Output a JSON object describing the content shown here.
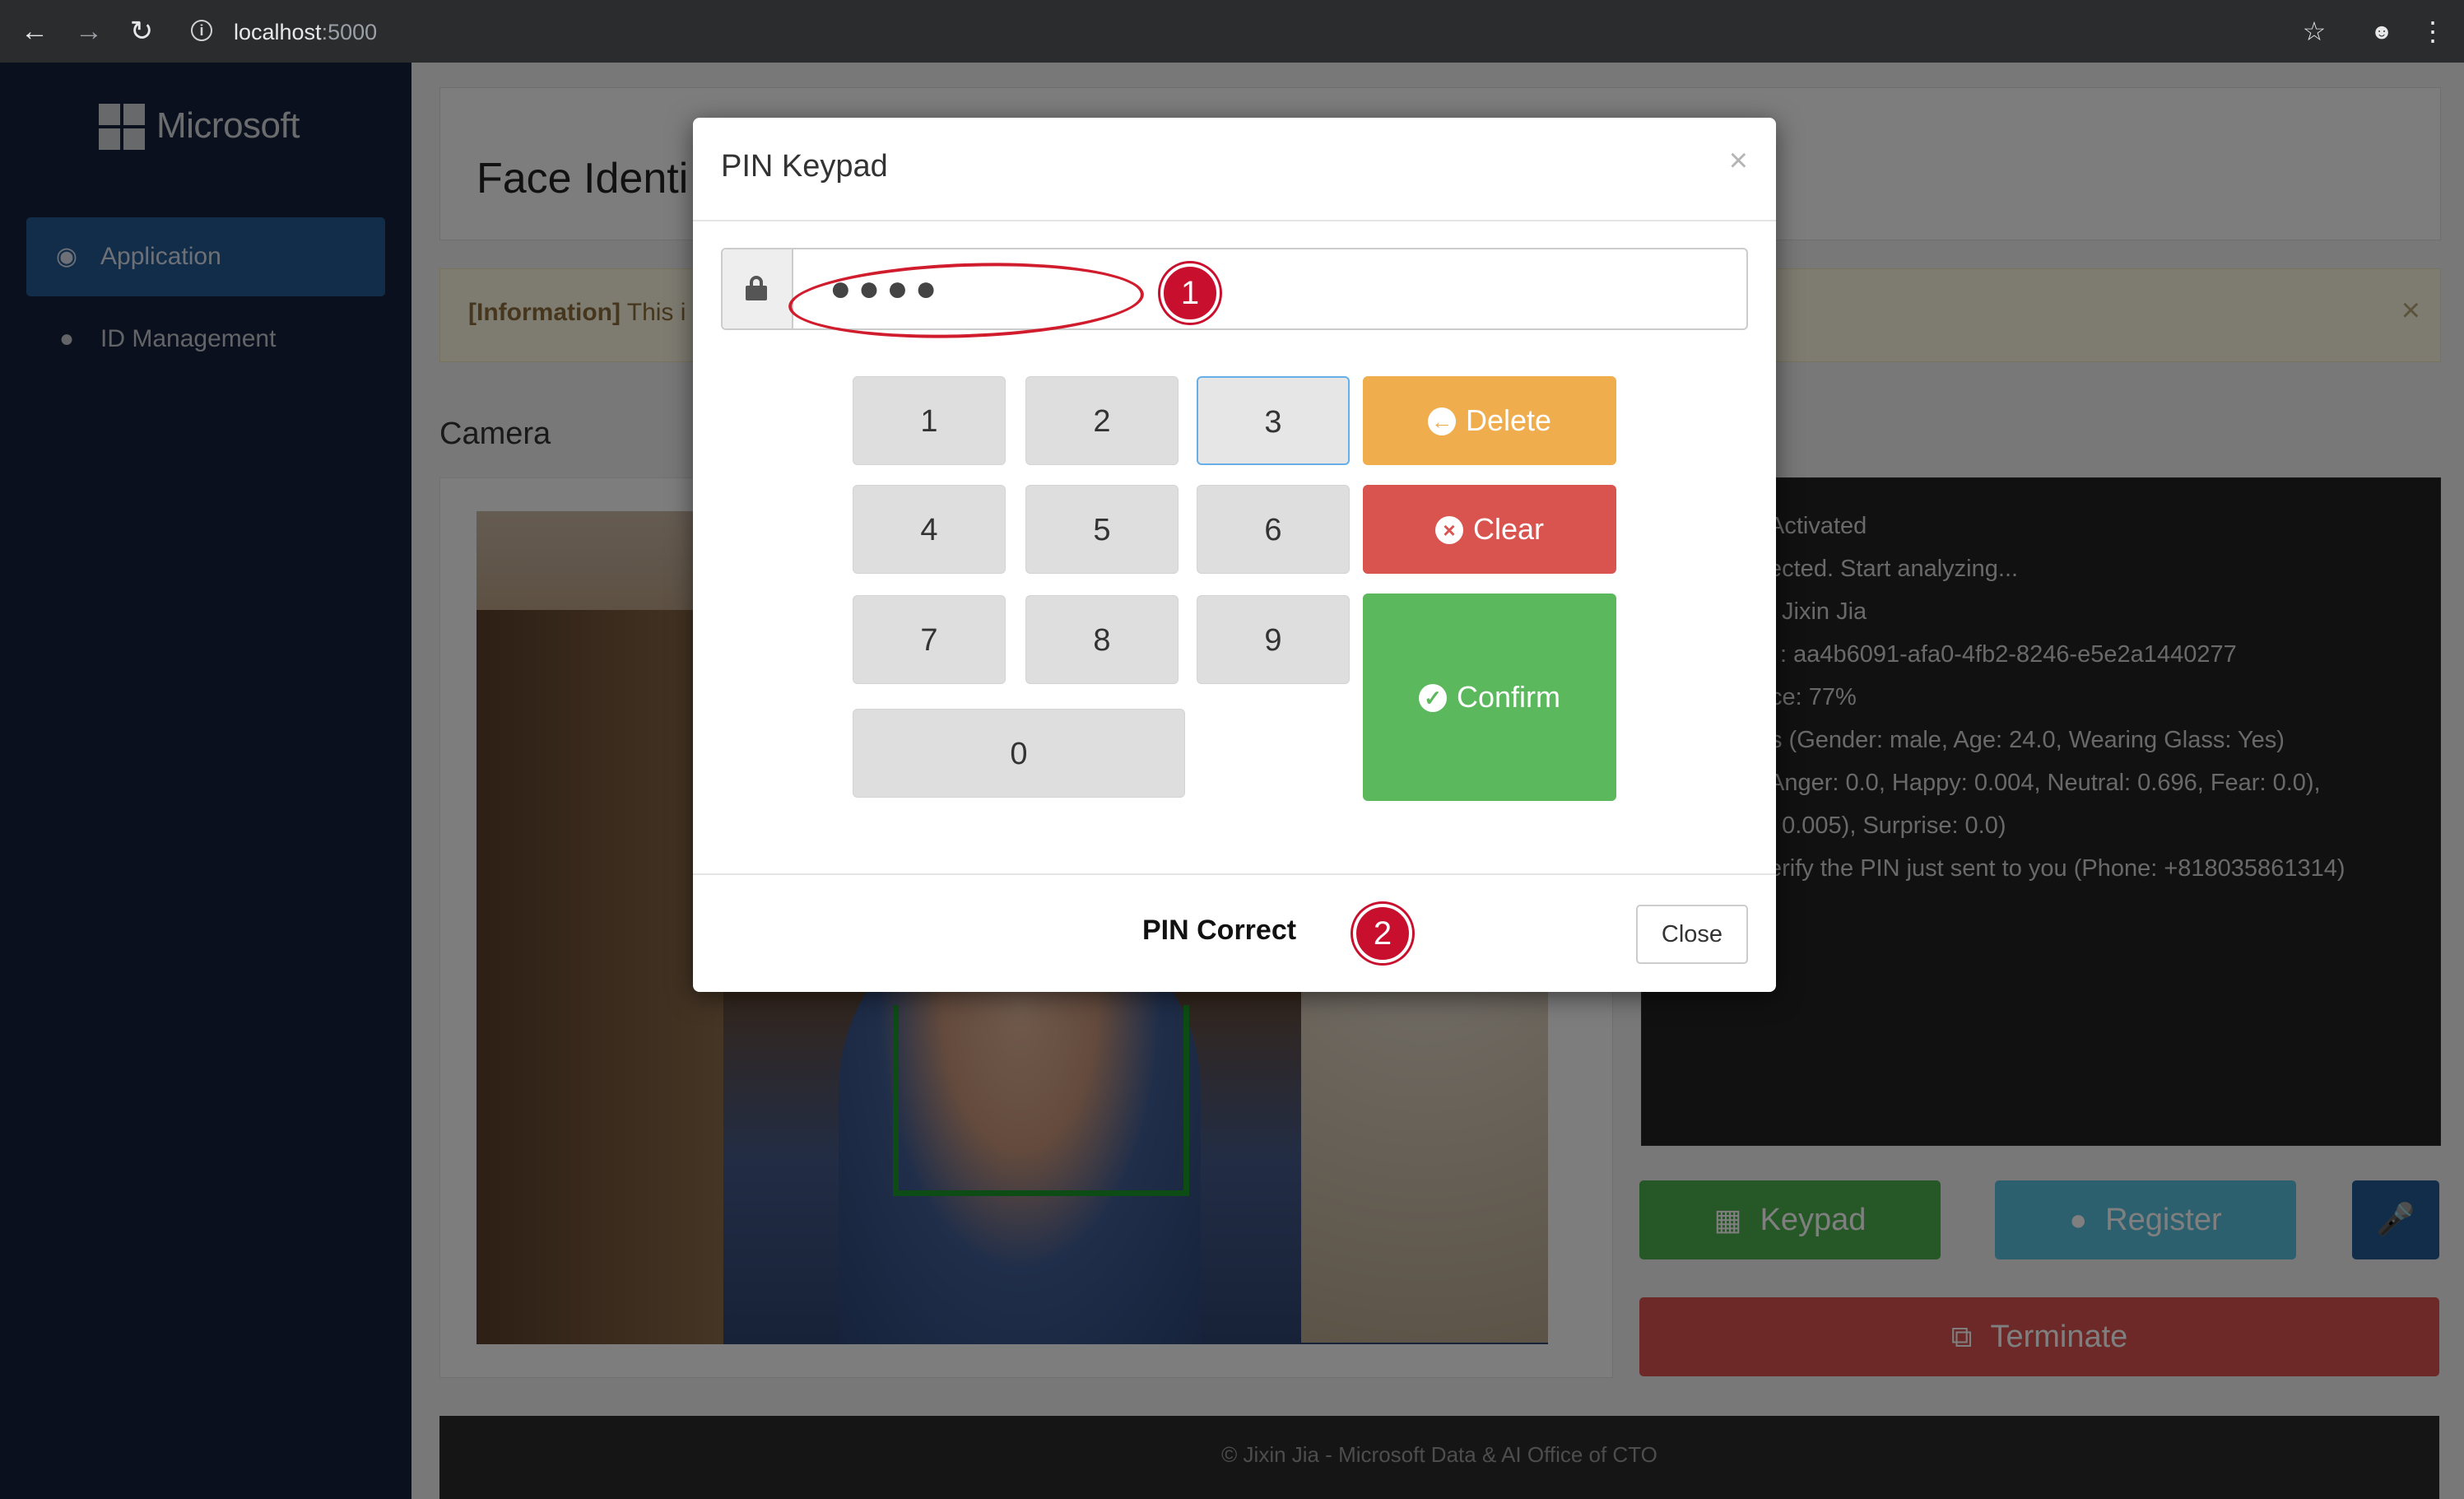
{
  "browser": {
    "url_host": "localhost",
    "url_port": ":5000",
    "back_icon": "back-arrow-icon",
    "forward_icon": "forward-arrow-icon",
    "reload_icon": "reload-icon",
    "bookmark_icon": "star-icon",
    "incognito_icon": "incognito-icon",
    "menu_icon": "kebab-menu-icon"
  },
  "sidebar": {
    "brand": "Microsoft",
    "items": [
      {
        "label": "Application",
        "icon": "eye-icon",
        "active": true
      },
      {
        "label": "ID Management",
        "icon": "user-icon",
        "active": false
      }
    ]
  },
  "main": {
    "title": "Face Identi",
    "info_bold": "[Information]",
    "info_text": " This i",
    "camera_title": "Camera",
    "log_lines": [
      "Activated",
      "ected. Start analyzing...",
      "Jixin Jia",
      ": aa4b6091-afa0-4fb2-8246-e5e2a1440277",
      "ce: 77%",
      "s (Gender: male, Age: 24.0, Wearing Glass: Yes)",
      "Anger: 0.0, Happy: 0.004, Neutral: 0.696, Fear: 0.0),",
      ": 0.005), Surprise: 0.0)",
      "erify the PIN just sent to you (Phone: +818035861314)"
    ],
    "buttons": {
      "keypad": "Keypad",
      "register": "Register",
      "terminate": "Terminate"
    },
    "footer": "© Jixin Jia - Microsoft Data & AI Office of CTO"
  },
  "modal": {
    "title": "PIN Keypad",
    "close_x": "×",
    "pin_masked": "●●●●",
    "keys": [
      "1",
      "2",
      "3",
      "4",
      "5",
      "6",
      "7",
      "8",
      "9",
      "0"
    ],
    "actions": {
      "delete": "Delete",
      "clear": "Clear",
      "confirm": "Confirm"
    },
    "status": "PIN Correct",
    "close_label": "Close",
    "annotations": [
      "1",
      "2"
    ],
    "annotation_color": "#c8102e"
  }
}
